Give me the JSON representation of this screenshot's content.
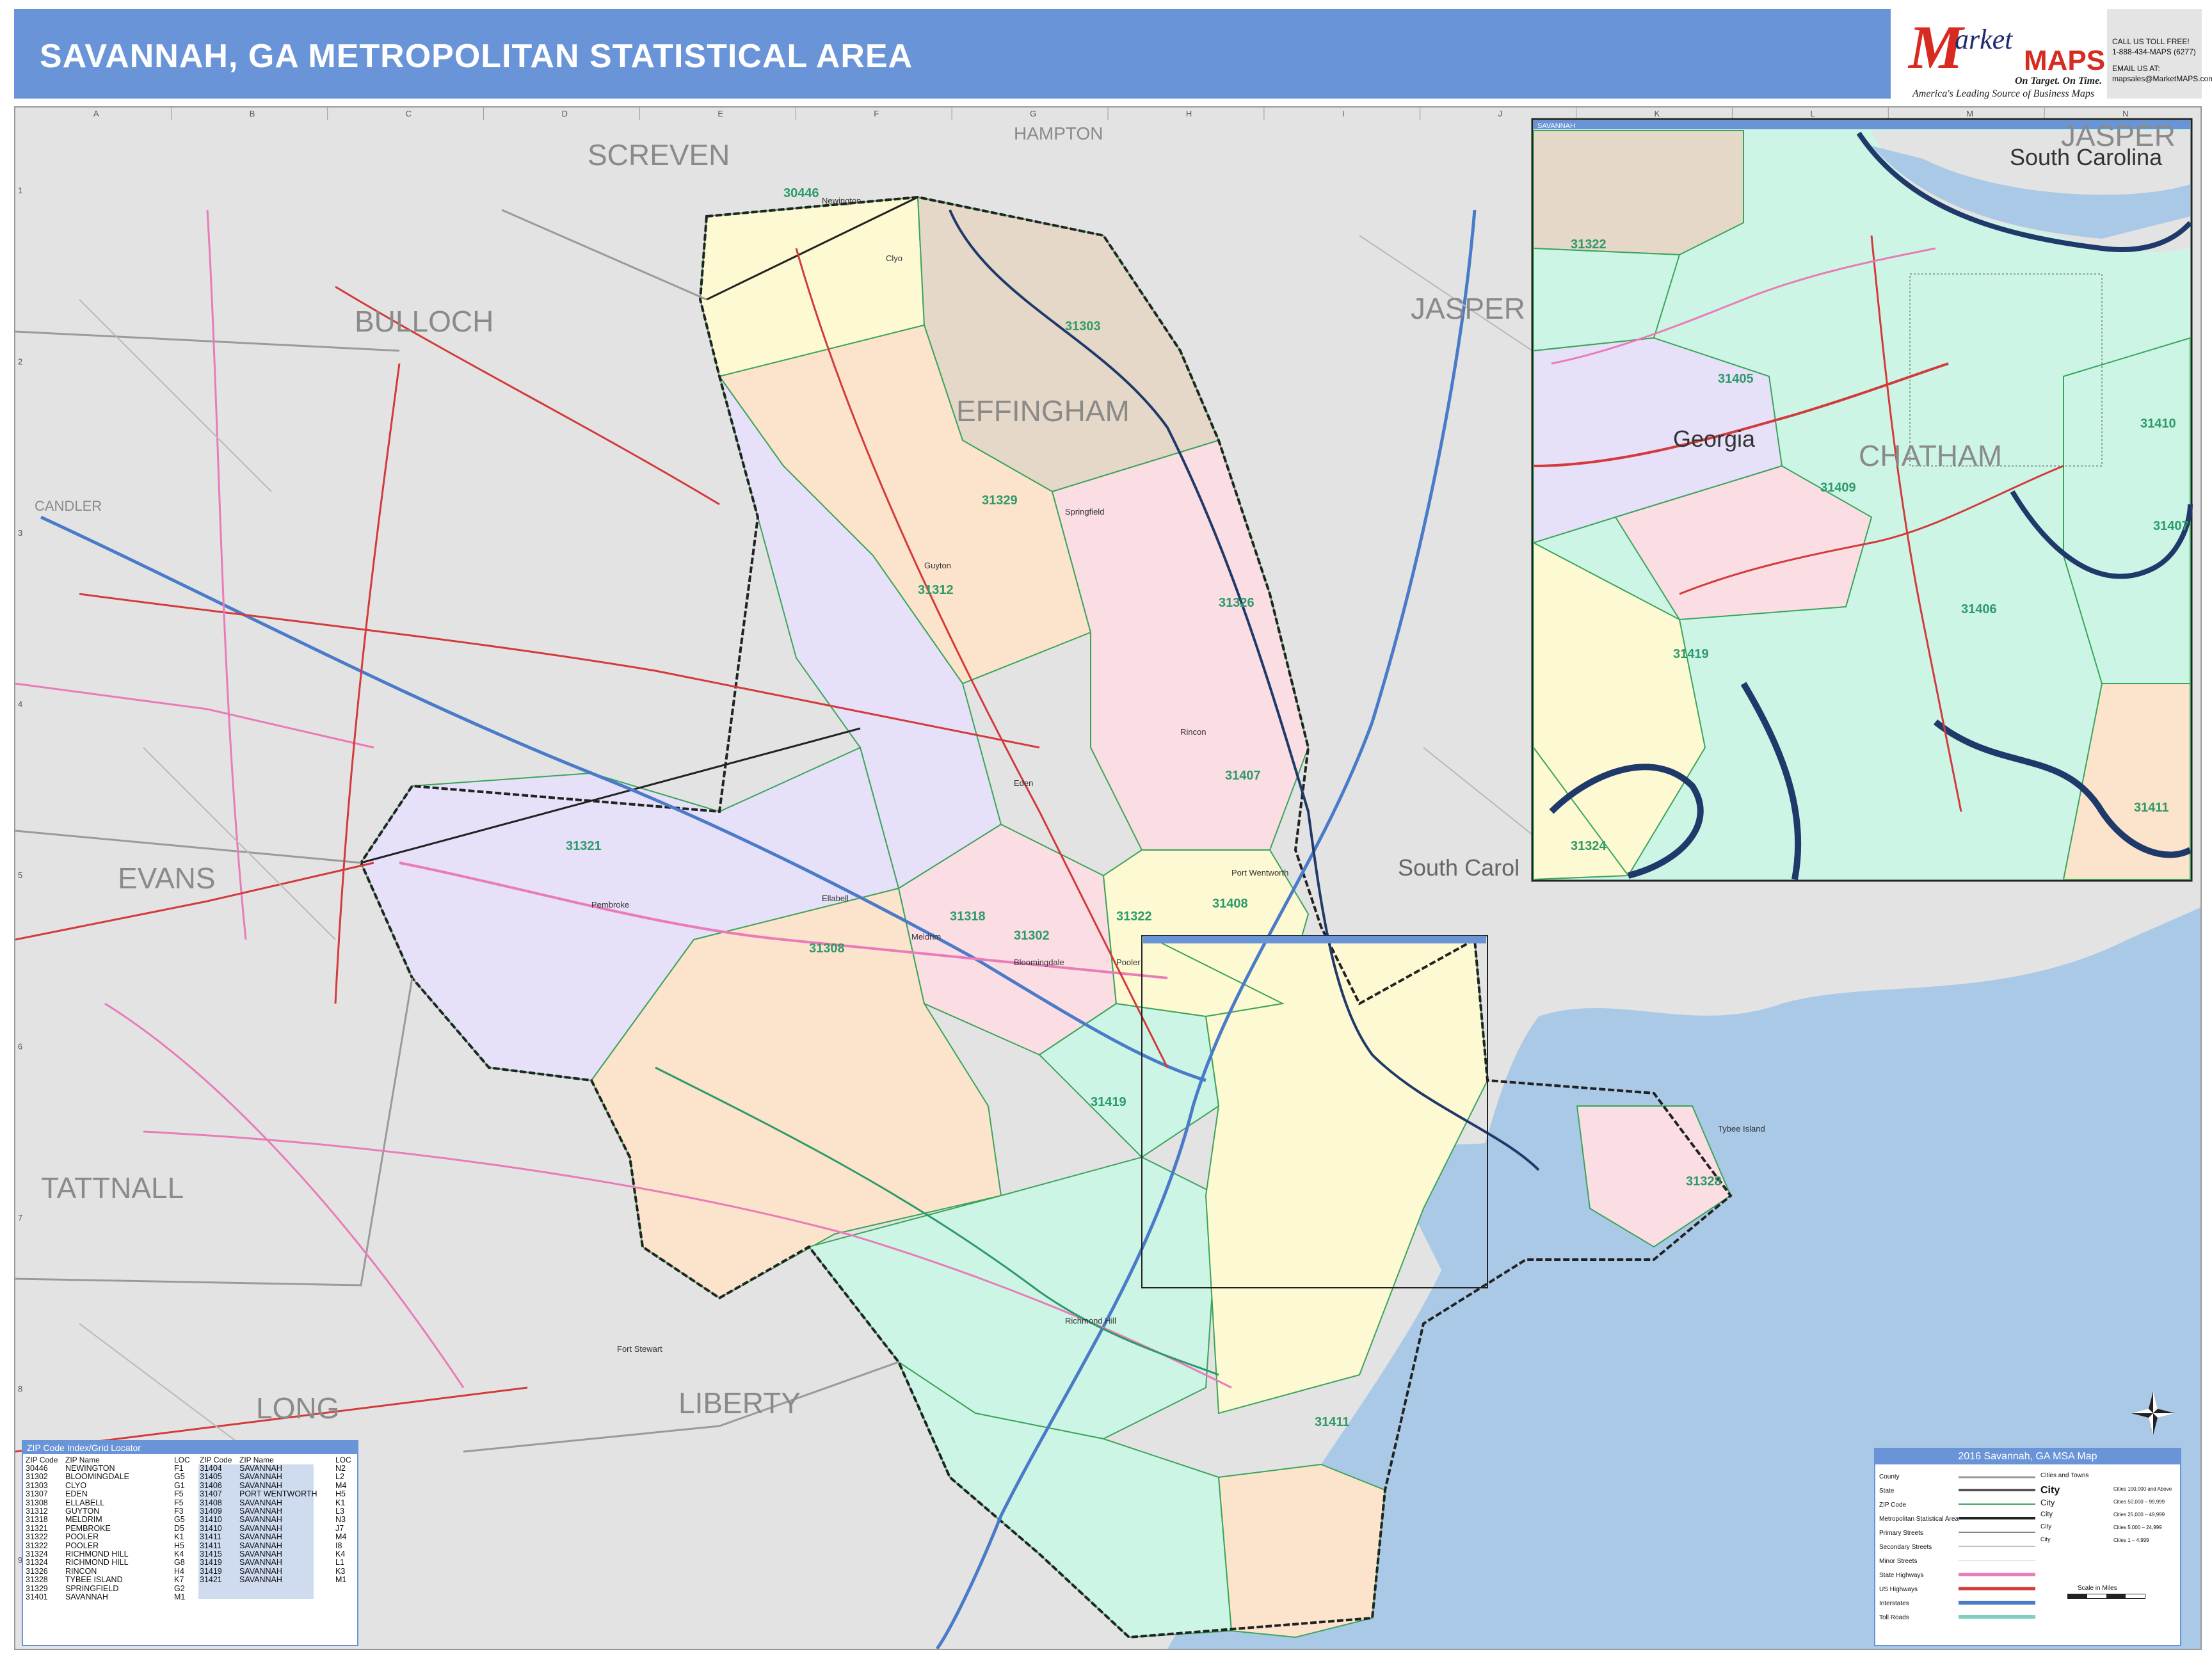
{
  "header": {
    "title": "SAVANNAH, GA METROPOLITAN STATISTICAL AREA"
  },
  "logo": {
    "m": "M",
    "arket": "arket",
    "maps": "MAPS",
    "tagline": "On Target. On Time.",
    "subtitle": "America's Leading Source of Business Maps"
  },
  "contact": {
    "line1": "CALL US TOLL FREE!",
    "line2": "1-888-434-MAPS (6277)",
    "line3": "EMAIL US AT:",
    "line4": "mapsales@MarketMAPS.com"
  },
  "grid": {
    "letters": [
      "A",
      "B",
      "C",
      "D",
      "E",
      "F",
      "G",
      "H",
      "I",
      "J",
      "K",
      "L",
      "M",
      "N"
    ],
    "numbers": [
      "1",
      "2",
      "3",
      "4",
      "5",
      "6",
      "7",
      "8",
      "9"
    ]
  },
  "counties": {
    "screven": "SCREVEN",
    "hampton": "HAMPTON",
    "jasper_main": "JASPER",
    "jasper_inset": "JASPER",
    "bulloch": "BULLOCH",
    "effingham": "EFFINGHAM",
    "candler": "CANDLER",
    "evans": "EVANS",
    "tattnall": "TATTNALL",
    "long": "LONG",
    "liberty": "LIBERTY",
    "chatham_inset": "CHATHAM",
    "south_carolina_main": "South Carol",
    "south_carolina_inset": "South Carolina",
    "georgia_inset": "Georgia"
  },
  "zip_labels_main": [
    "30446",
    "31303",
    "31329",
    "31312",
    "31326",
    "31321",
    "31308",
    "31318",
    "31302",
    "31407",
    "31408",
    "31322",
    "31419",
    "31328",
    "31411"
  ],
  "zip_labels_inset": [
    "31322",
    "31405",
    "31409",
    "31419",
    "31406",
    "31410",
    "31324",
    "31411",
    "31407"
  ],
  "places": [
    "Clyo",
    "Springfield",
    "Guyton",
    "Rincon",
    "Pembroke",
    "Ellabell",
    "Pooler",
    "Richmond Hill",
    "Fort Stewart",
    "Tybee Island",
    "Port Wentworth",
    "Bloomingdale",
    "Meldrim",
    "Eden",
    "Newington"
  ],
  "inset_tag": "SAVANNAH",
  "zip_table": {
    "title": "ZIP Code Index/Grid Locator",
    "headers": [
      "ZIP Code",
      "ZIP Name",
      "LOC",
      "ZIP Code",
      "ZIP Name",
      "LOC"
    ],
    "left": [
      [
        "30446",
        "NEWINGTON",
        "F1"
      ],
      [
        "31302",
        "BLOOMINGDALE",
        "G5"
      ],
      [
        "31303",
        "CLYO",
        "G1"
      ],
      [
        "31307",
        "EDEN",
        "F5"
      ],
      [
        "31308",
        "ELLABELL",
        "F5"
      ],
      [
        "31312",
        "GUYTON",
        "F3"
      ],
      [
        "31318",
        "MELDRIM",
        "G5"
      ],
      [
        "31321",
        "PEMBROKE",
        "D5"
      ],
      [
        "31322",
        "POOLER",
        "K1"
      ],
      [
        "31322",
        "POOLER",
        "H5"
      ],
      [
        "31324",
        "RICHMOND HILL",
        "K4"
      ],
      [
        "31324",
        "RICHMOND HILL",
        "G8"
      ],
      [
        "31326",
        "RINCON",
        "H4"
      ],
      [
        "31328",
        "TYBEE ISLAND",
        "K7"
      ],
      [
        "31329",
        "SPRINGFIELD",
        "G2"
      ],
      [
        "31401",
        "SAVANNAH",
        "M1"
      ]
    ],
    "right": [
      [
        "31404",
        "SAVANNAH",
        "N2"
      ],
      [
        "31405",
        "SAVANNAH",
        "L2"
      ],
      [
        "31406",
        "SAVANNAH",
        "M4"
      ],
      [
        "31407",
        "PORT WENTWORTH",
        "H5"
      ],
      [
        "31408",
        "SAVANNAH",
        "K1"
      ],
      [
        "31409",
        "SAVANNAH",
        "L3"
      ],
      [
        "31410",
        "SAVANNAH",
        "N3"
      ],
      [
        "31410",
        "SAVANNAH",
        "J7"
      ],
      [
        "31411",
        "SAVANNAH",
        "M4"
      ],
      [
        "31411",
        "SAVANNAH",
        "I8"
      ],
      [
        "31415",
        "SAVANNAH",
        "K4"
      ],
      [
        "31419",
        "SAVANNAH",
        "L1"
      ],
      [
        "31419",
        "SAVANNAH",
        "K3"
      ],
      [
        "31421",
        "SAVANNAH",
        "M1"
      ]
    ]
  },
  "legend": {
    "title": "2016 Savannah, GA MSA Map",
    "items": [
      "County",
      "State",
      "ZIP Code",
      "Metropolitan Statistical Area",
      "Primary Streets",
      "Secondary Streets",
      "Minor Streets",
      "State Highways",
      "US Highways",
      "Interstates",
      "Toll Roads"
    ],
    "cities_header": "Cities and Towns",
    "cities": [
      [
        "City",
        "Cities 100,000 and Above"
      ],
      [
        "City",
        "Cities 50,000 – 99,999"
      ],
      [
        "City",
        "Cities 25,000 – 49,999"
      ],
      [
        "City",
        "Cities 5,000 – 24,999"
      ],
      [
        "City",
        "Cities 1 – 4,999"
      ]
    ],
    "scale_label": "Scale in Miles"
  },
  "colors": {
    "header_blue": "#6a94d8",
    "water": "#a9c9e6",
    "land_outside": "#e3e3e3",
    "zip_purple": "#e6e0f8",
    "zip_orange": "#fce3cc",
    "zip_pink": "#fbdde4",
    "zip_mint": "#ccf5e6",
    "zip_yellow": "#fdf9d2",
    "zip_tan": "#e6d8c8",
    "road_red": "#d33a3a",
    "road_pink": "#e97bb8",
    "zip_border_green": "#3aa55a"
  }
}
